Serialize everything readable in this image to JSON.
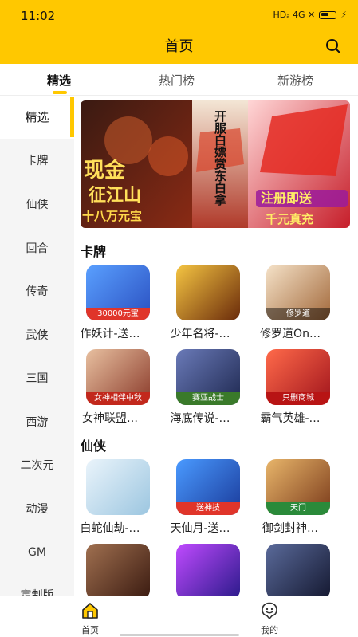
{
  "status_bar": {
    "time": "11:02",
    "network": "HDₐ  4G  ✕"
  },
  "header": {
    "title": "首页"
  },
  "tabs": [
    {
      "label": "精选",
      "active": true
    },
    {
      "label": "热门榜",
      "active": false
    },
    {
      "label": "新游榜",
      "active": false
    }
  ],
  "sidebar": {
    "items": [
      "精选",
      "卡牌",
      "仙侠",
      "回合",
      "传奇",
      "武侠",
      "三国",
      "西游",
      "二次元",
      "动漫",
      "GM",
      "定制版"
    ],
    "selected": "精选"
  },
  "banner": {
    "left_text_1": "现金",
    "left_text_2": "征江山",
    "left_text_3": "十八万元宝",
    "middle_text": "开服白嫖赏东白拿",
    "right_text_1": "注册即送",
    "right_text_2": "千元真充"
  },
  "sections": [
    {
      "title": "卡牌",
      "games": [
        {
          "name": "作妖计-送…",
          "tag": "30000元宝",
          "color": "#3d7be0"
        },
        {
          "name": "少年名将-…",
          "tag": "",
          "color": "#7a3b10"
        },
        {
          "name": "修罗道On…",
          "tag": "修罗道",
          "color": "#c9a27a"
        },
        {
          "name": "女神联盟…",
          "tag": "女神相伴中秋",
          "color": "#c77a4a"
        },
        {
          "name": "海底传说-…",
          "tag": "赛亚战士",
          "color": "#3a4a7a"
        },
        {
          "name": "霸气英雄-…",
          "tag": "只删商城",
          "color": "#d23c2a"
        }
      ]
    },
    {
      "title": "仙侠",
      "games": [
        {
          "name": "白蛇仙劫-…",
          "tag": "",
          "color": "#cfe3f2"
        },
        {
          "name": "天仙月-送…",
          "tag": "送神技",
          "color": "#2e6fd6"
        },
        {
          "name": "御剑封神…",
          "tag": "天门",
          "color": "#b5763a"
        },
        {
          "name": "",
          "tag": "",
          "color": "#5a3a2a"
        },
        {
          "name": "",
          "tag": "",
          "color": "#6a2fb3"
        },
        {
          "name": "",
          "tag": "",
          "color": "#2a2f4a"
        }
      ]
    }
  ],
  "bottom_nav": [
    {
      "label": "首页",
      "icon": "home-icon",
      "active": true
    },
    {
      "label": "我的",
      "icon": "chat-face-icon",
      "active": false
    }
  ],
  "colors": {
    "accent": "#FFC800",
    "sidebar_bg": "#f5f5f5"
  }
}
